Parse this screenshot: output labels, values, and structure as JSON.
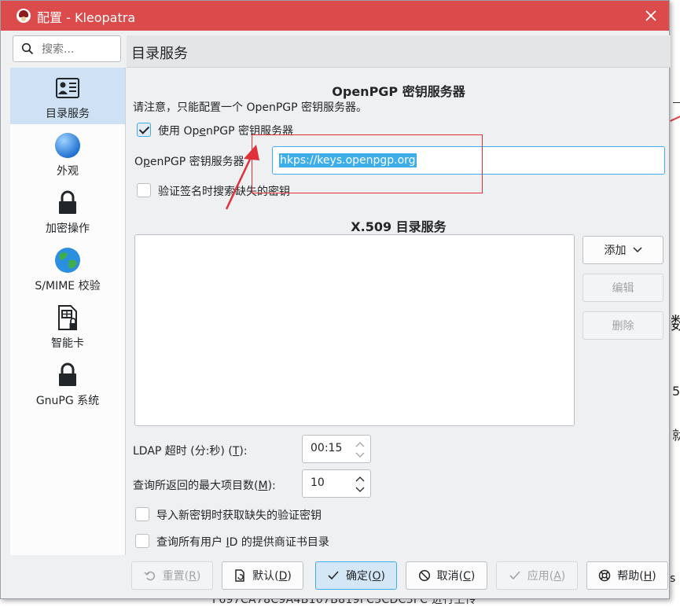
{
  "window": {
    "title": "配置 - Kleopatra"
  },
  "search": {
    "placeholder": "搜索..."
  },
  "sidebar": {
    "items": [
      {
        "label": "目录服务",
        "icon": "directory-services-icon",
        "active": true
      },
      {
        "label": "外观",
        "icon": "appearance-globe-icon",
        "active": false
      },
      {
        "label": "加密操作",
        "icon": "lock-icon",
        "active": false
      },
      {
        "label": "S/MIME 校验",
        "icon": "earth-globe-icon",
        "active": false
      },
      {
        "label": "智能卡",
        "icon": "smartcard-icon",
        "active": false
      },
      {
        "label": "GnuPG 系统",
        "icon": "lock-icon",
        "active": false
      }
    ]
  },
  "page": {
    "title": "目录服务",
    "openpgp": {
      "heading": "OpenPGP 密钥服务器",
      "note": "请注意，只能配置一个 OpenPGP 密钥服务器。",
      "use_server_pre": "使用 Op",
      "use_server_u": "e",
      "use_server_post": "nPGP 密钥服务器",
      "use_server_checked": true,
      "server_label_pre": "O",
      "server_label_u": "p",
      "server_label_post": "enPGP 密钥服务器",
      "server_value": "hkps://keys.openpgp.org",
      "verify_label": "验证签名时搜索缺失的密钥",
      "verify_checked": false
    },
    "x509": {
      "heading": "X.509 目录服务",
      "add_label": "添加",
      "edit_label": "编辑",
      "delete_label": "删除"
    },
    "ldap_timeout": {
      "label_pre": "LDAP 超时 (分:秒) (",
      "label_u": "T",
      "label_post": "):",
      "value": "00:15"
    },
    "max_items": {
      "label_pre": "查询所返回的最大项目数(",
      "label_u": "M",
      "label_post": "):",
      "value": "10"
    },
    "fetch_missing": {
      "label": "导入新密钥时获取缺失的验证密钥",
      "checked": false
    },
    "query_issuers": {
      "label_pre": "查询所有用户 ",
      "label_u": "I",
      "label_post": "D 的提供商证书目录",
      "checked": false
    }
  },
  "buttons": {
    "reset": {
      "pre": "重置(",
      "u": "R",
      "post": ")"
    },
    "defaults": {
      "pre": "默认(",
      "u": "D",
      "post": ")"
    },
    "ok": {
      "pre": "确定(",
      "u": "O",
      "post": ")"
    },
    "cancel": {
      "pre": "取消(",
      "u": "C",
      "post": ")"
    },
    "apply": {
      "pre": "应用(",
      "u": "A",
      "post": ")"
    },
    "help": {
      "pre": "帮助(",
      "u": "H",
      "post": ")"
    }
  },
  "background": {
    "t1": "数",
    "t2": "5",
    "t3": "就",
    "t4": "s",
    "bottom_line": "F697CA78C9A4B107B819FC3CDC3FC 进行上传"
  },
  "colors": {
    "titlebar": "#dc4b4b",
    "accent": "#3daee9",
    "annotation": "#e0303a"
  }
}
